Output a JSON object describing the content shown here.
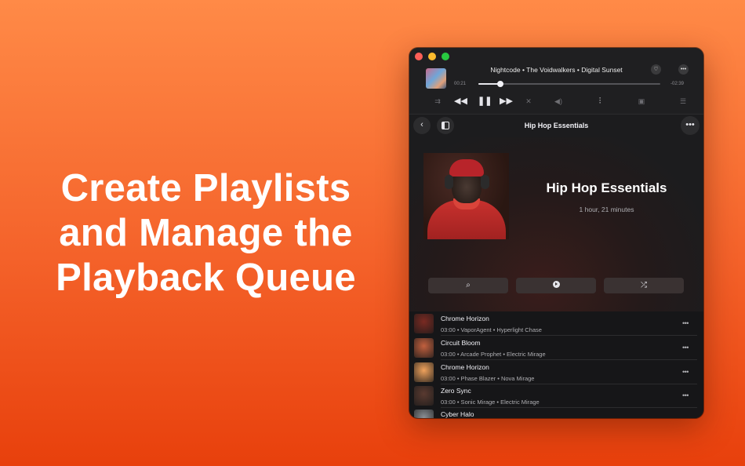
{
  "headline": {
    "lines": [
      "Create Playlists",
      "and Manage the",
      "Playback Queue"
    ]
  },
  "player": {
    "now_playing": "Nightcode • The Voidwalkers • Digital Sunset",
    "time_elapsed": "00:21",
    "time_remaining": "-02:39",
    "progress_fraction": 0.12,
    "icons": {
      "favorite": "heart-icon",
      "more": "ellipsis-icon",
      "queue_mode": "queue-mode-icon",
      "previous": "rewind-icon",
      "play_pause": "pause-icon",
      "next": "fast-forward-icon",
      "shuffle": "shuffle-icon",
      "volume": "volume-icon",
      "equalizer": "equalizer-icon",
      "lyrics": "lyrics-icon",
      "queue": "list-icon"
    }
  },
  "toolbar": {
    "title": "Hip Hop Essentials",
    "back": "chevron-left-icon",
    "sidebar": "sidebar-icon",
    "more": "ellipsis-icon"
  },
  "playlist": {
    "title": "Hip Hop Essentials",
    "duration": "1 hour, 21 minutes",
    "actions": [
      "search-icon",
      "play-icon",
      "shuffle-icon"
    ]
  },
  "tracks": [
    {
      "title": "Chrome Horizon",
      "meta": "03:00 • VaporAgent • Hyperlight Chase",
      "art_color": "#7a2a22"
    },
    {
      "title": "Circuit Bloom",
      "meta": "03:00 • Arcade Prophet • Electric Mirage",
      "art_color": "#c2603e"
    },
    {
      "title": "Chrome Horizon",
      "meta": "03:00 • Phase Blazer • Nova Mirage",
      "art_color": "#f0a25c"
    },
    {
      "title": "Zero Sync",
      "meta": "03:00 • Sonic Mirage • Electric Mirage",
      "art_color": "#5a3a30"
    },
    {
      "title": "Cyber Halo",
      "meta": "",
      "art_color": "#8a8f94"
    }
  ],
  "colors": {
    "background_top": "#ff8a47",
    "background_bottom": "#e8400c",
    "window_bg": "#1c1c1e"
  }
}
